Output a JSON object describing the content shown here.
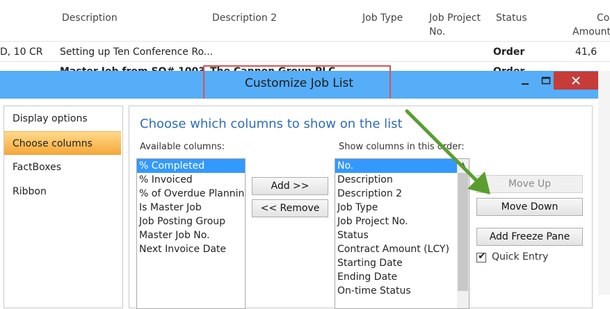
{
  "job_list": {
    "columns": [
      "Description",
      "Description 2",
      "Job Type",
      "Job Project",
      "No.",
      "Status",
      "Co",
      "Amount"
    ],
    "rows": [
      {
        "no_fragment": "D, 10 CR",
        "description": "Setting up Ten Conference Ro...",
        "status": "Order",
        "amount_fragment": "41,6"
      },
      {
        "description": "Master Job from SO# 1003",
        "description2": "The Cannon Group PLC",
        "status": "Order"
      }
    ]
  },
  "dialog": {
    "title": "Customize Job List",
    "minimize_icon": "minimize-icon",
    "maximize_icon": "maximize-icon",
    "close_icon": "close-icon"
  },
  "nav": {
    "items": [
      {
        "label": "Display options"
      },
      {
        "label": "Choose columns",
        "active": true
      },
      {
        "label": "FactBoxes"
      },
      {
        "label": "Ribbon"
      }
    ]
  },
  "content": {
    "heading": "Choose which columns to show on the list",
    "available_label": "Available columns:",
    "show_label": "Show columns in this order:",
    "available": [
      "% Completed",
      "% Invoiced",
      "% of Overdue Planning",
      "Is Master Job",
      "Job Posting Group",
      "Master Job No.",
      "Next Invoice Date"
    ],
    "shown": [
      "No.",
      "Description",
      "Description 2",
      "Job Type",
      "Job Project No.",
      "Status",
      "Contract Amount (LCY)",
      "Starting Date",
      "Ending Date",
      "On-time Status"
    ],
    "add_label": "Add >>",
    "remove_label": "<< Remove",
    "move_up_label": "Move Up",
    "move_down_label": "Move Down",
    "freeze_label": "Add Freeze Pane",
    "quick_entry_label": "Quick Entry",
    "quick_entry_checked": true
  },
  "colors": {
    "titlebar": "#56adf8",
    "close": "#c73b38",
    "heading": "#2e6db6",
    "selection": "#3399ff",
    "annotation_box": "#d9534f",
    "annotation_arrow": "#5a9e2f"
  }
}
